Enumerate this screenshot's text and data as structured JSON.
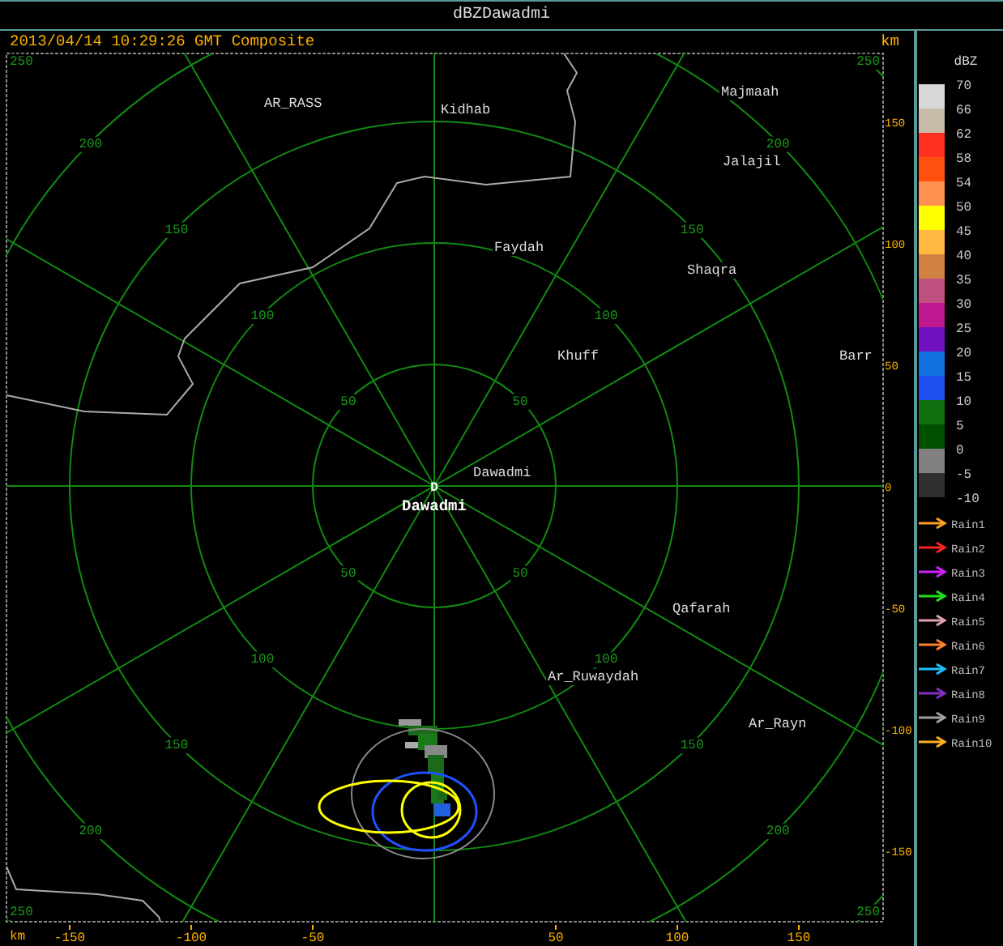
{
  "window": {
    "title": "dBZDawadmi"
  },
  "header": {
    "timestamp": "2013/04/14 10:29:26 GMT Composite",
    "unit": "km"
  },
  "plot": {
    "corner_labels": [
      "250",
      "250",
      "250",
      "250"
    ],
    "ring_labels": [
      "200",
      "200",
      "150",
      "150",
      "100",
      "100",
      "50",
      "50",
      "50",
      "50",
      "100",
      "100",
      "150",
      "150",
      "200",
      "200"
    ],
    "places": [
      {
        "name": "AR_RASS"
      },
      {
        "name": "Kidhab"
      },
      {
        "name": "Majmaah"
      },
      {
        "name": "Jalajil"
      },
      {
        "name": "Faydah"
      },
      {
        "name": "Shaqra"
      },
      {
        "name": "Khuff"
      },
      {
        "name": "Barr"
      },
      {
        "name": "Dawadmi"
      },
      {
        "name": "Qafarah"
      },
      {
        "name": "Ar_Ruwaydah"
      },
      {
        "name": "Ar_Rayn"
      }
    ],
    "site": {
      "marker": "D",
      "name": "Dawadmi"
    },
    "y_ticks": [
      "150",
      "100",
      "50",
      "0",
      "-50",
      "-100",
      "-150"
    ],
    "x_unit": "km",
    "x_ticks": [
      "-150",
      "-100",
      "-50",
      "50",
      "100",
      "150"
    ]
  },
  "legend": {
    "title": "dBZ",
    "bins": [
      {
        "label": "70",
        "color": "#d8d8d8"
      },
      {
        "label": "66",
        "color": "#c8bca8"
      },
      {
        "label": "62",
        "color": "#ff3020"
      },
      {
        "label": "58",
        "color": "#ff5010"
      },
      {
        "label": "54",
        "color": "#ff9050"
      },
      {
        "label": "50",
        "color": "#ffff00"
      },
      {
        "label": "45",
        "color": "#ffb840"
      },
      {
        "label": "40",
        "color": "#d08040"
      },
      {
        "label": "35",
        "color": "#c05080"
      },
      {
        "label": "30",
        "color": "#c01890"
      },
      {
        "label": "25",
        "color": "#7010c0"
      },
      {
        "label": "20",
        "color": "#1070e0"
      },
      {
        "label": "15",
        "color": "#2050f0"
      },
      {
        "label": "10",
        "color": "#107010"
      },
      {
        "label": "5",
        "color": "#005000"
      },
      {
        "label": "0",
        "color": "#808080"
      },
      {
        "label": "-5",
        "color": "#303030"
      }
    ],
    "min_label": "-10",
    "tracks": [
      {
        "label": "Rain1",
        "color": "#ffa020"
      },
      {
        "label": "Rain2",
        "color": "#ff2020"
      },
      {
        "label": "Rain3",
        "color": "#d020ff"
      },
      {
        "label": "Rain4",
        "color": "#20e020"
      },
      {
        "label": "Rain5",
        "color": "#e0a0b0"
      },
      {
        "label": "Rain6",
        "color": "#ff8030"
      },
      {
        "label": "Rain7",
        "color": "#20c0ff"
      },
      {
        "label": "Rain8",
        "color": "#8030c0"
      },
      {
        "label": "Rain9",
        "color": "#a0a0a0"
      },
      {
        "label": "Rain10",
        "color": "#ffb020"
      }
    ]
  }
}
